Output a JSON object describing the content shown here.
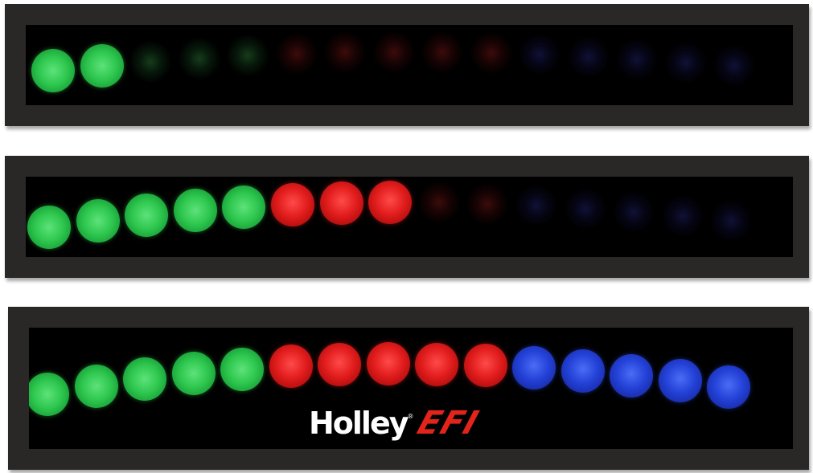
{
  "panels": [
    {
      "name": "shift-light-panel-1",
      "leds": [
        {
          "color": "green",
          "on": true
        },
        {
          "color": "green",
          "on": true
        },
        {
          "color": "green",
          "on": false
        },
        {
          "color": "green",
          "on": false
        },
        {
          "color": "green",
          "on": false
        },
        {
          "color": "red",
          "on": false
        },
        {
          "color": "red",
          "on": false
        },
        {
          "color": "red",
          "on": false
        },
        {
          "color": "red",
          "on": false
        },
        {
          "color": "red",
          "on": false
        },
        {
          "color": "blue",
          "on": false
        },
        {
          "color": "blue",
          "on": false
        },
        {
          "color": "blue",
          "on": false
        },
        {
          "color": "blue",
          "on": false
        },
        {
          "color": "blue",
          "on": false
        }
      ]
    },
    {
      "name": "shift-light-panel-2",
      "leds": [
        {
          "color": "green",
          "on": true
        },
        {
          "color": "green",
          "on": true
        },
        {
          "color": "green",
          "on": true
        },
        {
          "color": "green",
          "on": true
        },
        {
          "color": "green",
          "on": true
        },
        {
          "color": "red",
          "on": true
        },
        {
          "color": "red",
          "on": true
        },
        {
          "color": "red",
          "on": true
        },
        {
          "color": "red",
          "on": false
        },
        {
          "color": "red",
          "on": false
        },
        {
          "color": "blue",
          "on": false
        },
        {
          "color": "blue",
          "on": false
        },
        {
          "color": "blue",
          "on": false
        },
        {
          "color": "blue",
          "on": false
        },
        {
          "color": "blue",
          "on": false
        }
      ]
    },
    {
      "name": "shift-light-panel-3",
      "leds": [
        {
          "color": "green",
          "on": true
        },
        {
          "color": "green",
          "on": true
        },
        {
          "color": "green",
          "on": true
        },
        {
          "color": "green",
          "on": true
        },
        {
          "color": "green",
          "on": true
        },
        {
          "color": "red",
          "on": true
        },
        {
          "color": "red",
          "on": true
        },
        {
          "color": "red",
          "on": true
        },
        {
          "color": "red",
          "on": true
        },
        {
          "color": "red",
          "on": true
        },
        {
          "color": "blue",
          "on": true
        },
        {
          "color": "blue",
          "on": true
        },
        {
          "color": "blue",
          "on": true
        },
        {
          "color": "blue",
          "on": true
        },
        {
          "color": "blue",
          "on": true
        }
      ]
    }
  ],
  "logo": {
    "brand": "Holley",
    "reg_mark": "®",
    "product": "EFI"
  },
  "colors": {
    "panel_frame": "#2a2727",
    "panel_face": "#000000",
    "green": "#2fc84f",
    "red": "#e21d1d",
    "blue": "#2442d8",
    "logo_red": "#e3241b"
  }
}
